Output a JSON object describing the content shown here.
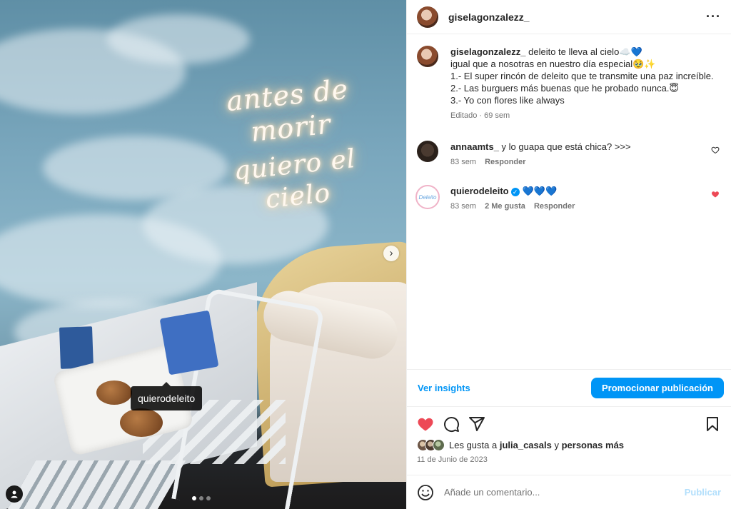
{
  "media": {
    "tag_label": "quierodeleito",
    "next_icon": "chevron-right-icon",
    "user_icon": "user-tag-icon",
    "carousel_dots": 3
  },
  "header": {
    "username": "giselagonzalezz_",
    "more_icon": "more-horizontal-icon"
  },
  "caption": {
    "username": "giselagonzalezz_",
    "text": "deleito te lleva al cielo☁️💙\nigual que a nosotras en nuestro día especial🥹✨\n1.- El super rincón de deleito que te transmite una paz increíble.\n2.- Las burguers más buenas que he probado nunca.😇\n3.- Yo con flores like always",
    "meta": "Editado · 69 sem"
  },
  "comments": [
    {
      "username": "annaamts_",
      "text": "y lo guapa que está chica? >>>",
      "time": "83 sem",
      "reply": "Responder",
      "liked": false
    },
    {
      "username": "quierodeleito",
      "avatar_text": "Deleito",
      "verified": true,
      "text": "💙💙💙",
      "time": "83 sem",
      "likes": "2 Me gusta",
      "reply": "Responder",
      "liked": true
    }
  ],
  "insights": {
    "link": "Ver insights",
    "promote": "Promocionar publicación"
  },
  "actions": {
    "liked": true,
    "likes_prefix": "Les gusta a",
    "likes_user": "julia_casals",
    "likes_and": "y",
    "likes_more": "personas más",
    "date": "11 de Junio de 2023"
  },
  "add_comment": {
    "placeholder": "Añade un comentario...",
    "publish": "Publicar"
  },
  "colors": {
    "accent": "#0095f6",
    "like_red": "#ed4956"
  }
}
